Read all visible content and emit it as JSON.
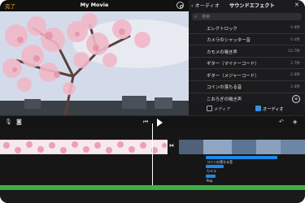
{
  "app": {
    "done_label": "完了",
    "project_title": "My Movie"
  },
  "browser": {
    "back_label": "オーディオ",
    "title": "サウンドエフェクト",
    "search_placeholder": "検索",
    "items": [
      {
        "name": "エレクトロック",
        "duration": "0.8秒"
      },
      {
        "name": "カメラのシャッター音",
        "duration": "0.4秒"
      },
      {
        "name": "カモメの鳴き声",
        "duration": "15.7秒"
      },
      {
        "name": "ギター（マイナーコード）",
        "duration": "2.7秒"
      },
      {
        "name": "ギター（メジャーコード）",
        "duration": "2.8秒"
      },
      {
        "name": "コインの落ちる音",
        "duration": "2.8秒"
      },
      {
        "name": "こおろぎの鳴き声",
        "duration": ""
      }
    ],
    "tabs": [
      {
        "label": "メディア"
      },
      {
        "label": "オーディオ"
      }
    ]
  },
  "timeline": {
    "audio_clips": [
      {
        "label": "コインの落ちる音"
      },
      {
        "label": "カメラ"
      },
      {
        "label": "Pop"
      }
    ]
  },
  "colors": {
    "accent": "#f0a33a",
    "audio_blue": "#1f88e8",
    "track_green": "#3cb043"
  }
}
